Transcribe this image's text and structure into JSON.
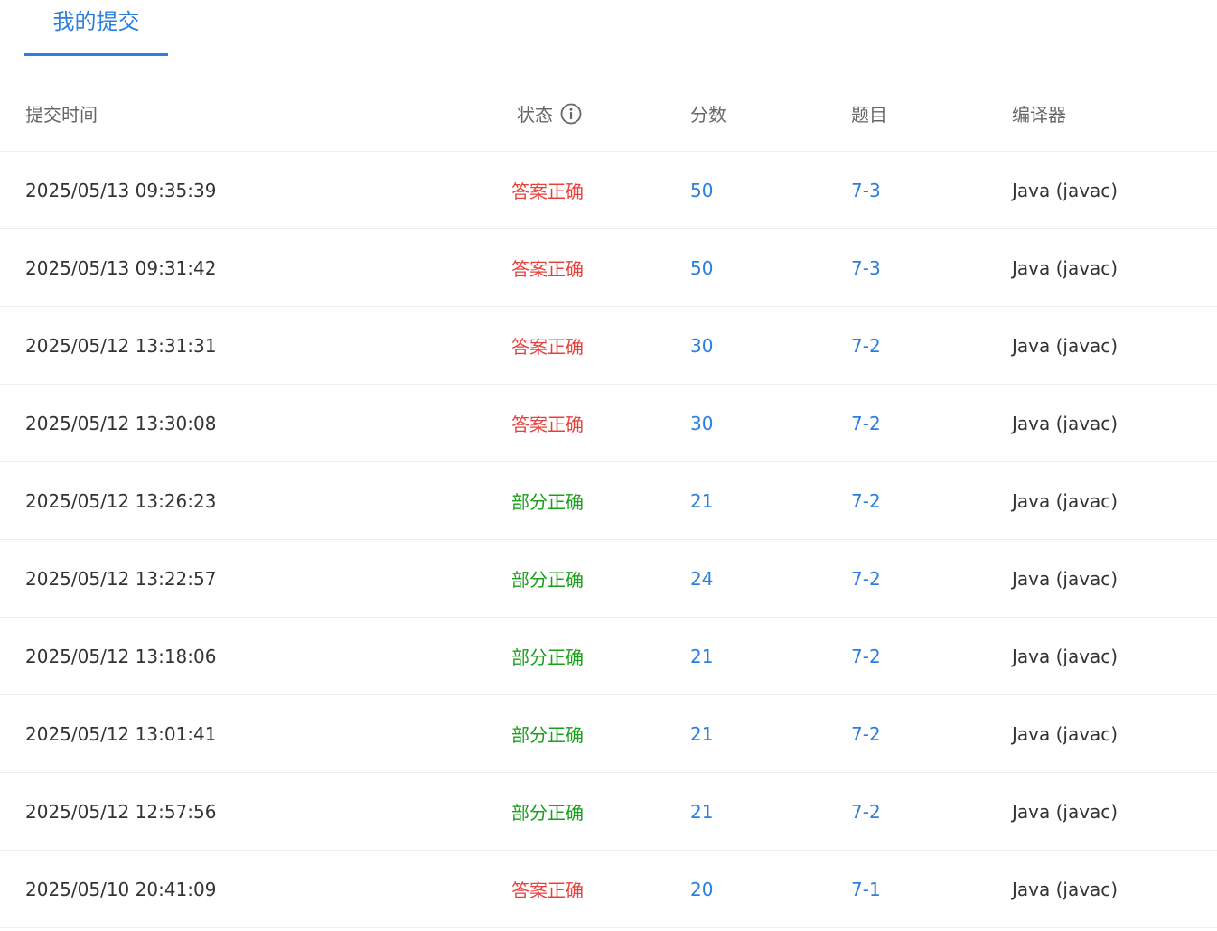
{
  "tabs": {
    "active_label": "我的提交"
  },
  "table": {
    "headers": {
      "time": "提交时间",
      "status": "状态",
      "score": "分数",
      "problem": "题目",
      "compiler": "编译器"
    },
    "rows": [
      {
        "time": "2025/05/13 09:35:39",
        "status": "答案正确",
        "score": "50",
        "problem": "7-3",
        "compiler": "Java (javac)"
      },
      {
        "time": "2025/05/13 09:31:42",
        "status": "答案正确",
        "score": "50",
        "problem": "7-3",
        "compiler": "Java (javac)"
      },
      {
        "time": "2025/05/12 13:31:31",
        "status": "答案正确",
        "score": "30",
        "problem": "7-2",
        "compiler": "Java (javac)"
      },
      {
        "time": "2025/05/12 13:30:08",
        "status": "答案正确",
        "score": "30",
        "problem": "7-2",
        "compiler": "Java (javac)"
      },
      {
        "time": "2025/05/12 13:26:23",
        "status": "部分正确",
        "score": "21",
        "problem": "7-2",
        "compiler": "Java (javac)"
      },
      {
        "time": "2025/05/12 13:22:57",
        "status": "部分正确",
        "score": "24",
        "problem": "7-2",
        "compiler": "Java (javac)"
      },
      {
        "time": "2025/05/12 13:18:06",
        "status": "部分正确",
        "score": "21",
        "problem": "7-2",
        "compiler": "Java (javac)"
      },
      {
        "time": "2025/05/12 13:01:41",
        "status": "部分正确",
        "score": "21",
        "problem": "7-2",
        "compiler": "Java (javac)"
      },
      {
        "time": "2025/05/12 12:57:56",
        "status": "部分正确",
        "score": "21",
        "problem": "7-2",
        "compiler": "Java (javac)"
      },
      {
        "time": "2025/05/10 20:41:09",
        "status": "答案正确",
        "score": "20",
        "problem": "7-1",
        "compiler": "Java (javac)"
      }
    ]
  },
  "colors": {
    "accent": "#2b7fe0",
    "status_accepted": "#e8413c",
    "status_partial": "#1aa01a"
  },
  "icons": {
    "status_info": "info-circle-icon"
  }
}
